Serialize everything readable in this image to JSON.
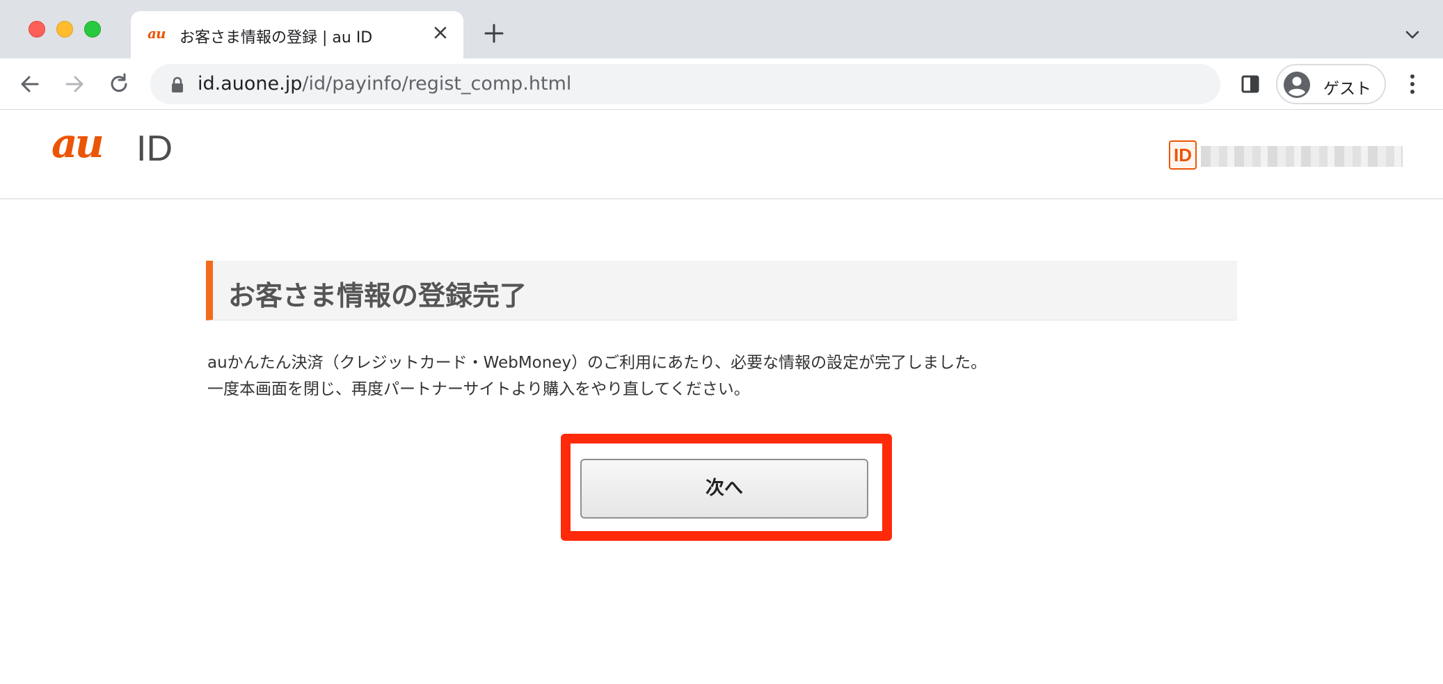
{
  "browser": {
    "tab_title": "お客さま情報の登録 | au ID",
    "tab_favicon_text": "au",
    "url_host": "id.auone.jp",
    "url_path": "/id/payinfo/regist_comp.html",
    "profile_label": "ゲスト"
  },
  "header": {
    "logo_au": "au",
    "logo_id": "ID",
    "user_id_badge": "ID"
  },
  "main": {
    "heading": "お客さま情報の登録完了",
    "message_lines": [
      "auかんたん決済（クレジットカード・WebMoney）のご利用にあたり、必要な情報の設定が完了しました。",
      "一度本画面を閉じ、再度パートナーサイトより購入をやり直してください。"
    ],
    "next_button_label": "次へ"
  },
  "colors": {
    "brand_orange": "#eb5505",
    "heading_accent": "#f26b1d",
    "highlight_red": "#ff2a0a"
  }
}
